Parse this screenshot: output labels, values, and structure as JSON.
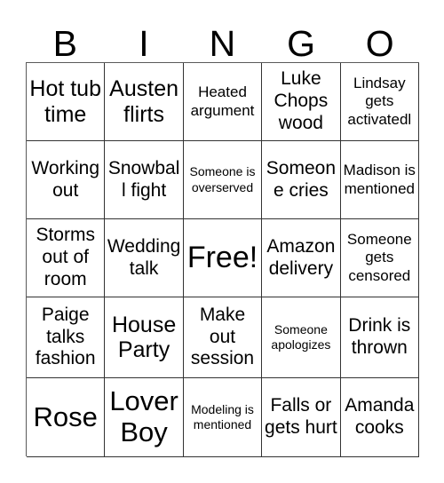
{
  "card": {
    "title_letters": [
      "B",
      "I",
      "N",
      "G",
      "O"
    ],
    "columns": 5,
    "rows": 5,
    "free_space_label": "Free!",
    "free_space_position": {
      "row": 3,
      "column": 3
    },
    "border_color": "#333333",
    "text_color": "#000000",
    "background_color": "#ffffff",
    "cells": [
      [
        {
          "text": "Hot tub time",
          "size": "lg"
        },
        {
          "text": "Austen flirts",
          "size": "lg"
        },
        {
          "text": "Heated argument",
          "size": "sm"
        },
        {
          "text": "Luke Chops wood",
          "size": "md"
        },
        {
          "text": "Lindsay gets activatedl",
          "size": "sm"
        }
      ],
      [
        {
          "text": "Working out",
          "size": "md"
        },
        {
          "text": "Snowball fight",
          "size": "md"
        },
        {
          "text": "Someone is overserved",
          "size": "xs"
        },
        {
          "text": "Someone cries",
          "size": "md"
        },
        {
          "text": "Madison is mentioned",
          "size": "sm"
        }
      ],
      [
        {
          "text": "Storms out of room",
          "size": "md"
        },
        {
          "text": "Wedding talk",
          "size": "md"
        },
        {
          "text": "Free!",
          "size": "free"
        },
        {
          "text": "Amazon delivery",
          "size": "md"
        },
        {
          "text": "Someone gets censored",
          "size": "sm"
        }
      ],
      [
        {
          "text": "Paige talks fashion",
          "size": "md"
        },
        {
          "text": "House Party",
          "size": "lg"
        },
        {
          "text": "Make out session",
          "size": "md"
        },
        {
          "text": "Someone apologizes",
          "size": "xs"
        },
        {
          "text": "Drink is thrown",
          "size": "md"
        }
      ],
      [
        {
          "text": "Rose",
          "size": "xl"
        },
        {
          "text": "Lover Boy",
          "size": "xl"
        },
        {
          "text": "Modeling is mentioned",
          "size": "xs"
        },
        {
          "text": "Falls or gets hurt",
          "size": "md"
        },
        {
          "text": "Amanda cooks",
          "size": "md"
        }
      ]
    ]
  }
}
